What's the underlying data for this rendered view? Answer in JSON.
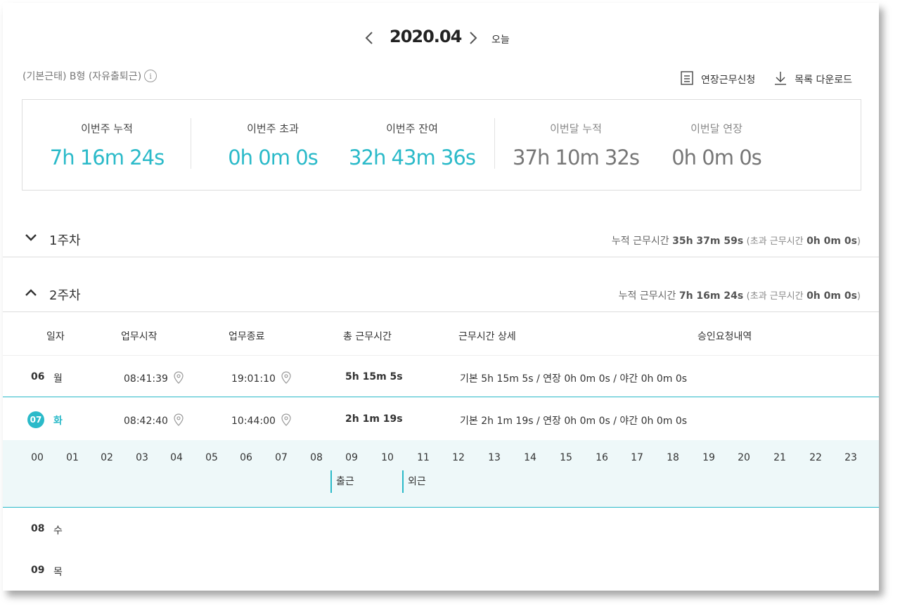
{
  "header": {
    "month": "2020.04",
    "today_label": "오늘"
  },
  "policy": {
    "label": "(기본근태) B형 (자유출퇴근)"
  },
  "actions": {
    "overtime_request": "연장근무신청",
    "download_list": "목록 다운로드"
  },
  "summary": {
    "items": [
      {
        "label": "이번주 누적",
        "value": "7h 16m 24s"
      },
      {
        "label": "이번주 초과",
        "value": "0h 0m 0s"
      },
      {
        "label": "이번주 잔여",
        "value": "32h 43m 36s"
      },
      {
        "label": "이번달 누적",
        "value": "37h 10m 32s"
      },
      {
        "label": "이번달 연장",
        "value": "0h 0m 0s"
      }
    ]
  },
  "weeks": [
    {
      "name": "1주차",
      "summary_prefix": "누적 근무시간",
      "total": "35h 37m 59s",
      "overtime_prefix": "(초과 근무시간",
      "overtime": "0h 0m 0s",
      "overtime_suffix": ")"
    },
    {
      "name": "2주차",
      "summary_prefix": "누적 근무시간",
      "total": "7h 16m 24s",
      "overtime_prefix": "(초과 근무시간",
      "overtime": "0h 0m 0s",
      "overtime_suffix": ")"
    }
  ],
  "table": {
    "headers": [
      "일자",
      "업무시작",
      "업무종료",
      "총 근무시간",
      "근무시간 상세",
      "승인요청내역"
    ],
    "rows": [
      {
        "day": "06",
        "weekday": "월",
        "start": "08:41:39",
        "end": "19:01:10",
        "total": "5h 15m 5s",
        "detail": "기본 5h 15m 5s / 연장 0h 0m 0s / 야간 0h 0m 0s"
      },
      {
        "day": "07",
        "weekday": "화",
        "start": "08:42:40",
        "end": "10:44:00",
        "total": "2h 1m 19s",
        "detail": "기본 2h 1m 19s / 연장 0h 0m 0s / 야간 0h 0m 0s"
      },
      {
        "day": "08",
        "weekday": "수"
      },
      {
        "day": "09",
        "weekday": "목"
      }
    ]
  },
  "timeline": {
    "hours": [
      "00",
      "01",
      "02",
      "03",
      "04",
      "05",
      "06",
      "07",
      "08",
      "09",
      "10",
      "11",
      "12",
      "13",
      "14",
      "15",
      "16",
      "17",
      "18",
      "19",
      "20",
      "21",
      "22",
      "23"
    ],
    "events": [
      {
        "label": "출근",
        "time": "08:42"
      },
      {
        "label": "외근",
        "time": "10:44"
      }
    ]
  },
  "colors": {
    "accent": "#2bbac9"
  }
}
